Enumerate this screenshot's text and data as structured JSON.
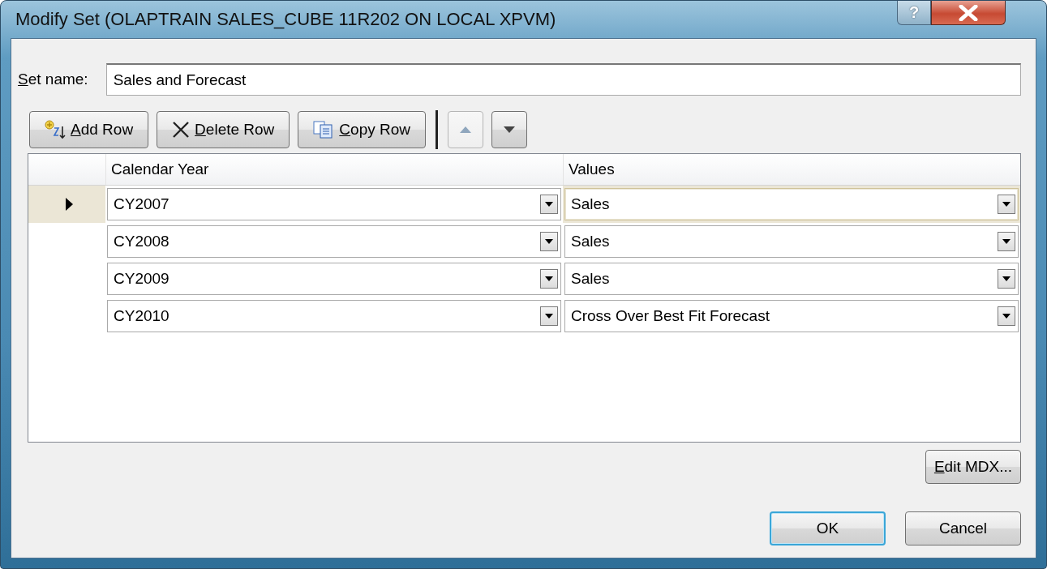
{
  "window": {
    "title": "Modify Set (OLAPTRAIN SALES_CUBE 11R202 ON LOCAL XPVM)",
    "help_label": "?"
  },
  "set_name": {
    "label": "Set name:",
    "mnemonic": true,
    "value": "Sales and Forecast"
  },
  "toolbar": [
    {
      "kind": "add",
      "label": "Add Row",
      "mnemonic": true
    },
    {
      "kind": "delete",
      "label": "Delete Row",
      "mnemonic": true
    },
    {
      "kind": "copy",
      "label": "Copy Row",
      "mnemonic": true
    },
    {
      "kind": "separator"
    },
    {
      "kind": "up",
      "disabled": true
    },
    {
      "kind": "down",
      "disabled": false
    }
  ],
  "grid": {
    "columns": [
      "Calendar Year",
      "Values"
    ],
    "rows": [
      {
        "current": true,
        "calendar_year": "CY2007",
        "values": "Sales"
      },
      {
        "current": false,
        "calendar_year": "CY2008",
        "values": "Sales"
      },
      {
        "current": false,
        "calendar_year": "CY2009",
        "values": "Sales"
      },
      {
        "current": false,
        "calendar_year": "CY2010",
        "values": "Cross Over Best Fit Forecast"
      }
    ]
  },
  "edit_mdx": {
    "label": "Edit MDX...",
    "mnemonic": true
  },
  "buttons": [
    {
      "label": "OK",
      "default": true
    },
    {
      "label": "Cancel",
      "default": false
    }
  ]
}
